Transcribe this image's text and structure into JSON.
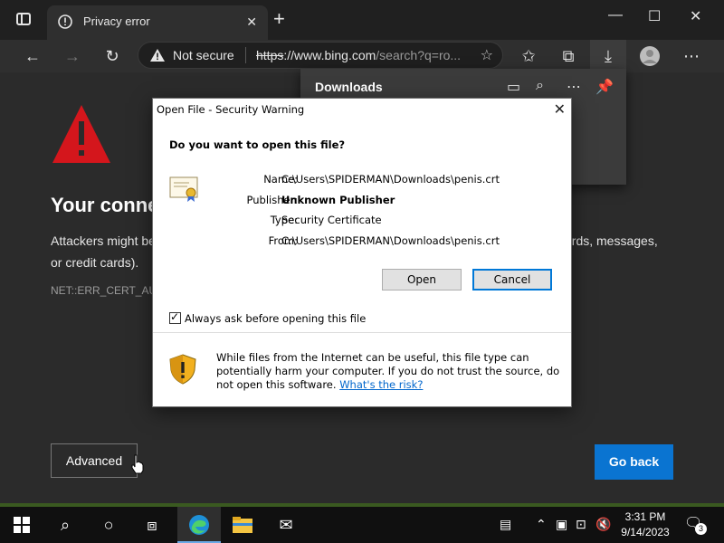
{
  "browser": {
    "tab_title": "Privacy error",
    "new_tab": "+",
    "window_controls": {
      "minimize": "—",
      "maximize": "☐",
      "close": "✕"
    },
    "address_bar": {
      "security_label": "Not secure",
      "url_scheme": "https",
      "url_host": "://www.bing.com",
      "url_rest": "/search?q=ro..."
    },
    "downloads_panel": {
      "title": "Downloads"
    }
  },
  "page": {
    "heading": "Your conne",
    "body_text_start": "Attackers might be",
    "body_text_end": "ords, messages,",
    "body_text_line2": "or credit cards).",
    "error_code": "NET::ERR_CERT_AUT",
    "advanced_label": "Advanced",
    "go_back_label": "Go back"
  },
  "dialog": {
    "title": "Open File - Security Warning",
    "question": "Do you want to open this file?",
    "fields": [
      {
        "label": "Name:",
        "value": "C:\\Users\\SPIDERMAN\\Downloads\\penis.crt",
        "bold": false
      },
      {
        "label": "Publisher:",
        "value": "Unknown Publisher",
        "bold": true
      },
      {
        "label": "Type:",
        "value": "Security Certificate",
        "bold": false
      },
      {
        "label": "From:",
        "value": "C:\\Users\\SPIDERMAN\\Downloads\\penis.crt",
        "bold": false
      }
    ],
    "open_label": "Open",
    "cancel_label": "Cancel",
    "checkbox_label": "Always ask before opening this file",
    "checkbox_checked": true,
    "warning_text": "While files from the Internet can be useful, this file type can potentially harm your computer. If you do not trust the source, do not open this software.",
    "risk_link": "What's the risk?"
  },
  "taskbar": {
    "time": "3:31 PM",
    "date": "9/14/2023",
    "notification_count": "3"
  },
  "colors": {
    "accent": "#0a74d1",
    "warning_red": "#d4161c",
    "link": "#0066cc"
  }
}
